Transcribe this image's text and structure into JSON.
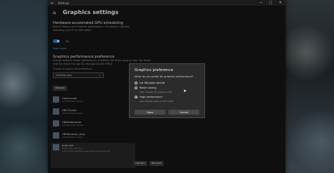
{
  "window": {
    "title": "Settings"
  },
  "page": {
    "title": "Graphics settings",
    "hags": {
      "heading": "Hardware-accelerated GPU scheduling",
      "description": "Reduce latency and improve performance. This feature requires restarting your PC to take effect.",
      "toggle_label": "On",
      "link": "Learn more"
    },
    "perf": {
      "heading": "Graphics performance preference",
      "description": "Choose between better performance or battery life when using an app. You might need to restart the app for changes to take effect.",
      "choose_label": "Choose an app to set preference",
      "app_type": "Desktop app",
      "browse_label": "Browse"
    },
    "apps": [
      {
        "name": "Homescape",
        "sub": "Let Windows decide"
      },
      {
        "name": "GBG Studio",
        "sub": "Let Windows decide"
      },
      {
        "name": "GBWebBrowser",
        "sub": "Let Windows decide"
      },
      {
        "name": "GBGBrowser_alias",
        "sub": "Let Windows decide"
      }
    ],
    "selected_app": {
      "name": "pcgh.exe",
      "sub": "High performance",
      "path": "C:\\Program Files\\Windows Defender\\pcgh.exe",
      "options_label": "Options",
      "remove_label": "Remove"
    }
  },
  "dialog": {
    "title": "Graphics preference",
    "question": "What do you prefer for graphics performance?",
    "options": [
      {
        "label": "Let Windows decide",
        "gpu": "",
        "checked": false
      },
      {
        "label": "Power saving",
        "gpu": "GPU: Intel(R) HD Graphics 630",
        "checked": false
      },
      {
        "label": "High performance",
        "gpu": "GPU: NVIDIA GeForce GTX 1050",
        "checked": true
      }
    ],
    "save_label": "Save",
    "cancel_label": "Cancel"
  }
}
